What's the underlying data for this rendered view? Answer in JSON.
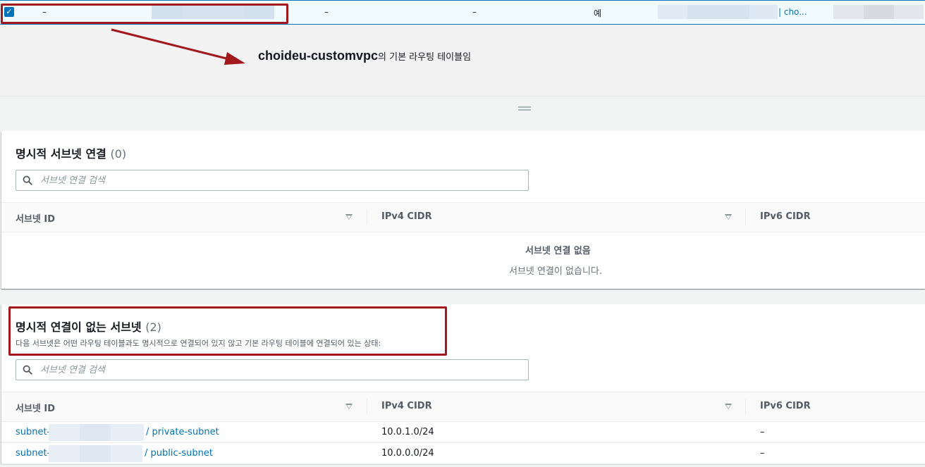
{
  "top_row": {
    "checked": true,
    "col1": "–",
    "col2": "–",
    "col3": "–",
    "col4": "예",
    "col5_link": "| cho..."
  },
  "annotation": {
    "bold": "choideu-customvpc",
    "rest": "의 기본 라우팅 테이블임",
    "accent_color": "#a3181d"
  },
  "explicit_panel": {
    "title": "명시적 서브넷 연결",
    "count": "(0)",
    "search_placeholder": "서브넷 연결 검색",
    "columns": [
      "서브넷 ID",
      "IPv4 CIDR",
      "IPv6 CIDR"
    ],
    "empty_title": "서브넷 연결 없음",
    "empty_desc": "서브넷 연결이 없습니다."
  },
  "implicit_panel": {
    "title": "명시적 연결이 없는 서브넷",
    "count": "(2)",
    "description": "다음 서브넷은 어떤 라우팅 테이블과도 명시적으로 연결되어 있지 않고 기본 라우팅 테이블에 연결되어 있는 상태:",
    "search_placeholder": "서브넷 연결 검색",
    "columns": [
      "서브넷 ID",
      "IPv4 CIDR",
      "IPv6 CIDR"
    ],
    "rows": [
      {
        "subnet_prefix": "subnet-",
        "subnet_name": "/ private-subnet",
        "ipv4": "10.0.1.0/24",
        "ipv6": "–"
      },
      {
        "subnet_prefix": "subnet-",
        "subnet_name": "/ public-subnet",
        "ipv4": "10.0.0.0/24",
        "ipv6": "–"
      }
    ]
  },
  "icons": {
    "checkbox": "checkbox-checked-icon",
    "search": "search-icon",
    "sort": "sort-down-icon",
    "resize": "drag-handle-icon"
  }
}
